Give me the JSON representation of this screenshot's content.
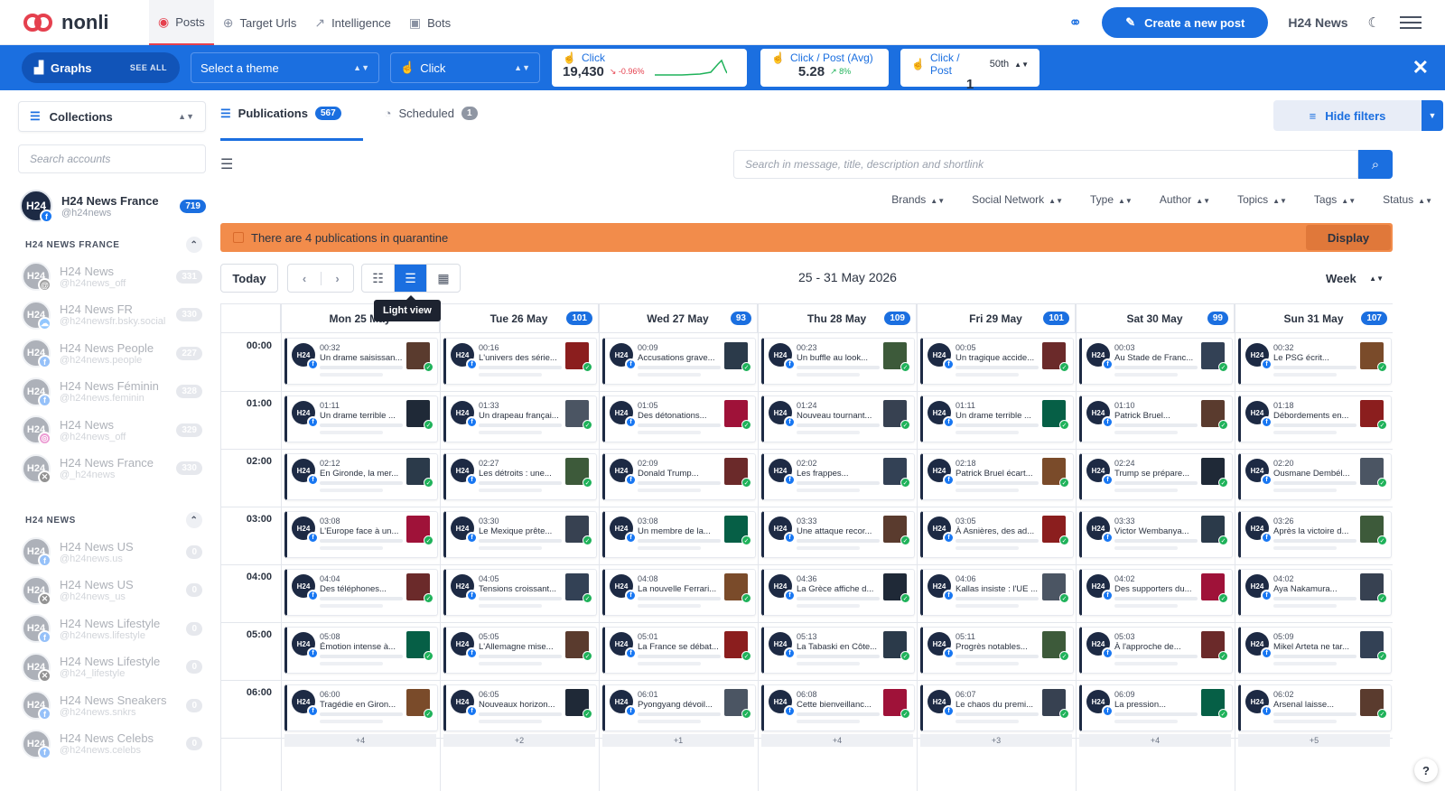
{
  "app": {
    "logo": "nonli"
  },
  "nav": [
    {
      "label": "Posts",
      "icon": "posts-icon",
      "active": true
    },
    {
      "label": "Target Urls",
      "icon": "target-icon",
      "active": false
    },
    {
      "label": "Intelligence",
      "icon": "intelligence-icon",
      "active": false
    },
    {
      "label": "Bots",
      "icon": "bot-icon",
      "active": false
    }
  ],
  "header": {
    "create_label": "Create a new post",
    "brand": "H24 News"
  },
  "statbar": {
    "graphs_label": "Graphs",
    "see_all": "SEE ALL",
    "theme_select": "Select a theme",
    "metric_select": "Click",
    "cards": [
      {
        "label": "Click",
        "value": "19,430",
        "trend": "↘ -0.96%",
        "trend_dir": "down"
      },
      {
        "label": "Click / Post (Avg)",
        "value": "5.28",
        "trend": "↗ 8%",
        "trend_dir": "up"
      },
      {
        "label": "Click / Post",
        "extra": "50th",
        "value": "1"
      }
    ]
  },
  "sidebar": {
    "collections_label": "Collections",
    "search_placeholder": "Search accounts",
    "main_account": {
      "name": "H24 News France",
      "handle": "@h24news",
      "count": "719",
      "initials": "H24"
    },
    "groups": [
      {
        "title": "H24 NEWS FRANCE",
        "accounts": [
          {
            "name": "H24 News",
            "handle": "@h24news_off",
            "count": "331",
            "net": "t"
          },
          {
            "name": "H24 News FR",
            "handle": "@h24newsfr.bsky.social",
            "count": "330",
            "net": "b"
          },
          {
            "name": "H24 News People",
            "handle": "@h24news.people",
            "count": "227",
            "net": "f"
          },
          {
            "name": "H24 News Féminin",
            "handle": "@h24news.feminin",
            "count": "328",
            "net": "f"
          },
          {
            "name": "H24 News",
            "handle": "@h24news_off",
            "count": "329",
            "net": "i"
          },
          {
            "name": "H24 News France",
            "handle": "@_h24news",
            "count": "330",
            "net": "x"
          }
        ]
      },
      {
        "title": "H24 NEWS",
        "accounts": [
          {
            "name": "H24 News US",
            "handle": "@h24news.us",
            "count": "0",
            "net": "f"
          },
          {
            "name": "H24 News US",
            "handle": "@h24news_us",
            "count": "0",
            "net": "x"
          },
          {
            "name": "H24 News Lifestyle",
            "handle": "@h24news.lifestyle",
            "count": "0",
            "net": "f"
          },
          {
            "name": "H24 News Lifestyle",
            "handle": "@h24_lifestyle",
            "count": "0",
            "net": "x"
          },
          {
            "name": "H24 News Sneakers",
            "handle": "@h24news.snkrs",
            "count": "0",
            "net": "f"
          },
          {
            "name": "H24 News Celebs",
            "handle": "@h24news.celebs",
            "count": "0",
            "net": "f"
          }
        ]
      }
    ]
  },
  "main": {
    "tabs": [
      {
        "label": "Publications",
        "count": "567",
        "active": true
      },
      {
        "label": "Scheduled",
        "count": "1",
        "active": false
      }
    ],
    "hide_filters": "Hide filters",
    "search_placeholder": "Search in message, title, description and shortlink",
    "filters": [
      "Brands",
      "Social Network",
      "Type",
      "Author",
      "Topics",
      "Tags",
      "Status"
    ],
    "quarantine_text": "There are 4 publications in quarantine",
    "display_label": "Display",
    "today_label": "Today",
    "tooltip": "Light view",
    "date_range": "25 - 31 May 2026",
    "period": "Week"
  },
  "calendar": {
    "days": [
      {
        "label": "Mon 25 May",
        "count": ""
      },
      {
        "label": "Tue 26 May",
        "count": "101"
      },
      {
        "label": "Wed 27 May",
        "count": "93"
      },
      {
        "label": "Thu 28 May",
        "count": "109"
      },
      {
        "label": "Fri 29 May",
        "count": "101"
      },
      {
        "label": "Sat 30 May",
        "count": "99"
      },
      {
        "label": "Sun 31 May",
        "count": "107"
      }
    ],
    "hours": [
      "00:00",
      "01:00",
      "02:00",
      "03:00",
      "04:00",
      "05:00",
      "06:00"
    ],
    "posts": [
      [
        [
          "00:32",
          "Un drame saisissan..."
        ],
        [
          "00:16",
          "L'univers des série..."
        ],
        [
          "00:09",
          "Accusations grave..."
        ],
        [
          "00:23",
          "Un buffle au look..."
        ],
        [
          "00:05",
          "Un tragique accide..."
        ],
        [
          "00:03",
          "Au Stade de Franc..."
        ],
        [
          "00:32",
          "Le PSG écrit..."
        ]
      ],
      [
        [
          "01:11",
          "Un drame terrible ..."
        ],
        [
          "01:33",
          "Un drapeau françai..."
        ],
        [
          "01:05",
          "Des détonations..."
        ],
        [
          "01:24",
          "Nouveau tournant..."
        ],
        [
          "01:11",
          "Un drame terrible ..."
        ],
        [
          "01:10",
          "Patrick Bruel..."
        ],
        [
          "01:18",
          "Débordements en..."
        ]
      ],
      [
        [
          "02:12",
          "En Gironde, la mer..."
        ],
        [
          "02:27",
          "Les détroits : une..."
        ],
        [
          "02:09",
          "Donald Trump..."
        ],
        [
          "02:02",
          "Les frappes..."
        ],
        [
          "02:18",
          "Patrick Bruel écart..."
        ],
        [
          "02:24",
          "Trump se prépare..."
        ],
        [
          "02:20",
          "Ousmane Dembél..."
        ]
      ],
      [
        [
          "03:08",
          "L'Europe face à un..."
        ],
        [
          "03:30",
          "Le Mexique prête..."
        ],
        [
          "03:08",
          "Un membre de la..."
        ],
        [
          "03:33",
          "Une attaque recor..."
        ],
        [
          "03:05",
          "À Asnières, des ad..."
        ],
        [
          "03:33",
          "Victor Wembanya..."
        ],
        [
          "03:26",
          "Après la victoire d..."
        ]
      ],
      [
        [
          "04:04",
          "Des téléphones..."
        ],
        [
          "04:05",
          "Tensions croissant..."
        ],
        [
          "04:08",
          "La nouvelle Ferrari..."
        ],
        [
          "04:36",
          "La Grèce affiche d..."
        ],
        [
          "04:06",
          "Kallas insiste : l'UE ..."
        ],
        [
          "04:02",
          "Des supporters du..."
        ],
        [
          "04:02",
          "Aya Nakamura..."
        ]
      ],
      [
        [
          "05:08",
          "Émotion intense à..."
        ],
        [
          "05:05",
          "L'Allemagne mise..."
        ],
        [
          "05:01",
          "La France se débat..."
        ],
        [
          "05:13",
          "La Tabaski en Côte..."
        ],
        [
          "05:11",
          "Progrès notables..."
        ],
        [
          "05:03",
          "À l'approche de..."
        ],
        [
          "05:09",
          "Mikel Arteta ne tar..."
        ]
      ],
      [
        [
          "06:00",
          "Tragédie en Giron..."
        ],
        [
          "06:05",
          "Nouveaux horizon..."
        ],
        [
          "06:01",
          "Pyongyang dévoil..."
        ],
        [
          "06:08",
          "Cette bienveillanc..."
        ],
        [
          "06:07",
          "Le chaos du premi..."
        ],
        [
          "06:09",
          "La pression..."
        ],
        [
          "06:02",
          "Arsenal laisse..."
        ]
      ]
    ],
    "more": [
      "+4",
      "+2",
      "+1",
      "+4",
      "+3",
      "+4",
      "+5"
    ]
  },
  "help_label": "?",
  "colors": {
    "accent": "#1b6fe0",
    "brand_red": "#e5404e",
    "warning": "#f28c4b",
    "success": "#1fb25a"
  }
}
